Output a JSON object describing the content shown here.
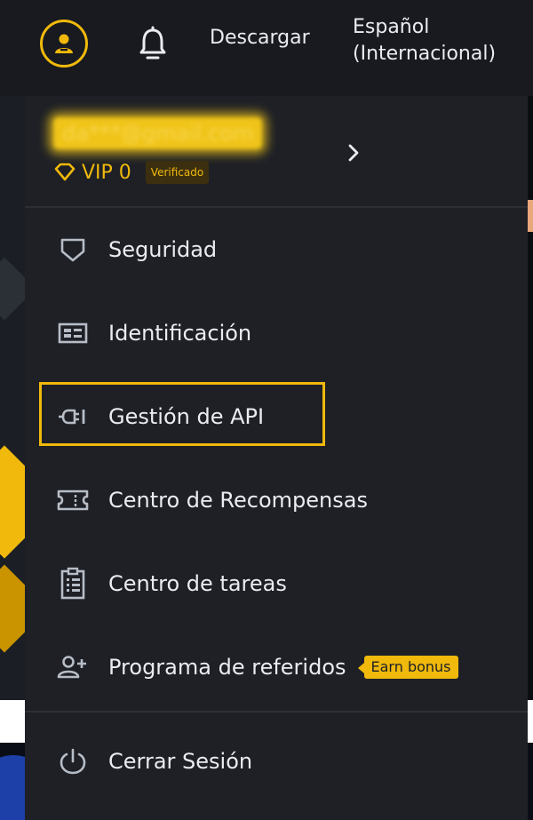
{
  "header": {
    "download_label": "Descargar",
    "language_line1": "Español",
    "language_line2": "(Internacional)"
  },
  "account": {
    "email_masked": "da***@gmail.com",
    "vip_label": "VIP 0",
    "verified_label": "Verificado"
  },
  "menu": {
    "items": [
      {
        "label": "Seguridad",
        "icon": "shield-icon"
      },
      {
        "label": "Identificación",
        "icon": "id-card-icon"
      },
      {
        "label": "Gestión de API",
        "icon": "api-plug-icon"
      },
      {
        "label": "Centro de Recompensas",
        "icon": "ticket-icon"
      },
      {
        "label": "Centro de tareas",
        "icon": "clipboard-icon"
      },
      {
        "label": "Programa de referidos",
        "icon": "add-user-icon",
        "badge": "Earn bonus"
      }
    ],
    "logout_label": "Cerrar Sesión",
    "highlighted_item": "Gestión de API"
  },
  "colors": {
    "accent": "#f0b90b",
    "menu_bg": "#1e2026",
    "topbar_bg": "#181a20",
    "text": "#eaecef"
  }
}
